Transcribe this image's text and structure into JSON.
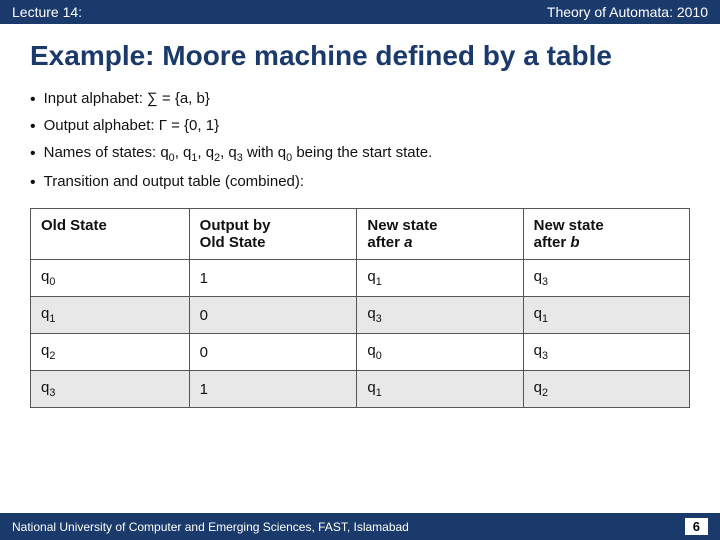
{
  "header": {
    "left": "Lecture 14:",
    "right": "Theory of Automata: 2010"
  },
  "title": "Example: Moore machine defined by a table",
  "bullets": [
    {
      "text": "Input alphabet: ∑ = {a, b}"
    },
    {
      "text": "Output alphabet: Γ = {0, 1}"
    },
    {
      "text": "Names of states: q₀, q₁, q₂, q₃ with q₀ being the start state."
    },
    {
      "text": "Transition and output table (combined):"
    }
  ],
  "table": {
    "headers": [
      "Old State",
      "Output by Old State",
      "New state after a",
      "New state after b"
    ],
    "rows": [
      [
        "q₀",
        "1",
        "q₁",
        "q₃"
      ],
      [
        "q₁",
        "0",
        "q₃",
        "q₁"
      ],
      [
        "q₂",
        "0",
        "q₀",
        "q₃"
      ],
      [
        "q₃",
        "1",
        "q₁",
        "q₂"
      ]
    ]
  },
  "footer": {
    "text": "National University of Computer and Emerging Sciences, FAST, Islamabad",
    "page": "6"
  }
}
